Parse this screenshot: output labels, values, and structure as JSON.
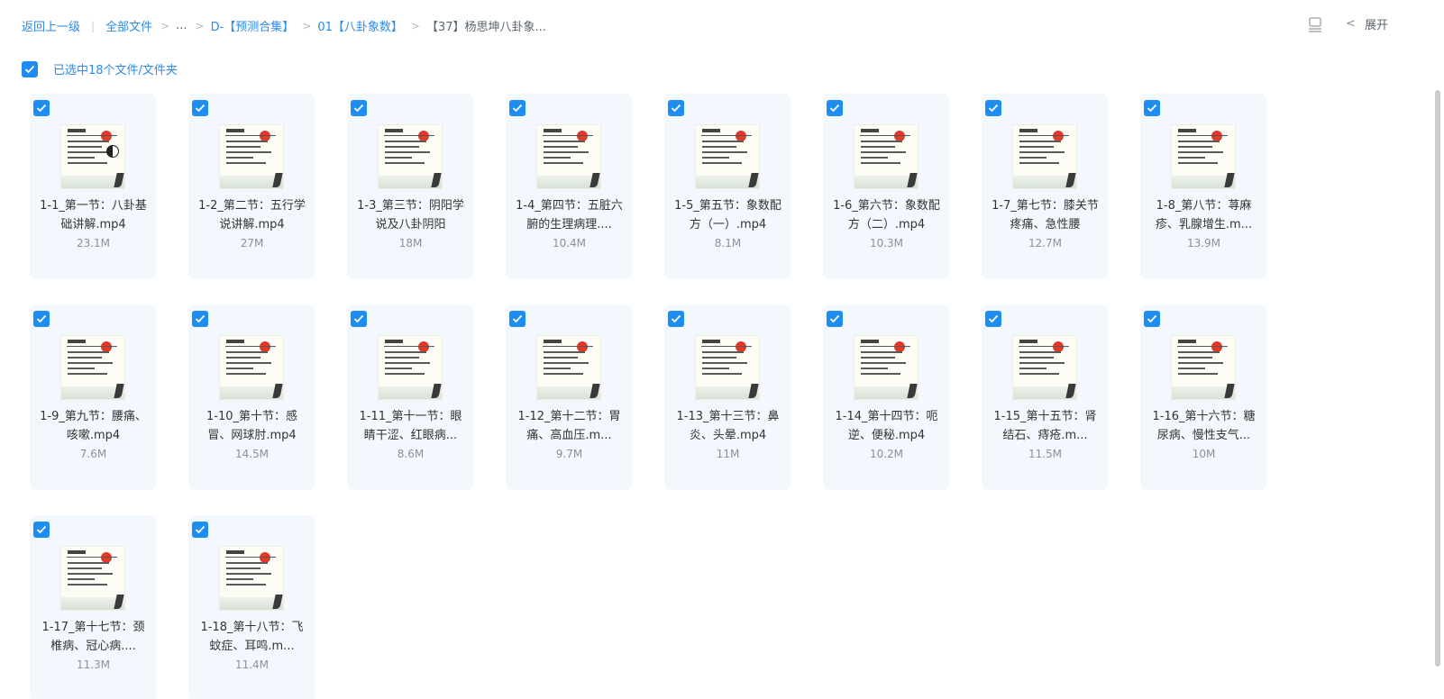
{
  "breadcrumb": {
    "back": "返回上一级",
    "root": "全部文件",
    "ellipsis": "...",
    "level1": "D-【预测合集】",
    "level2": "01【八卦象数】",
    "current": "【37】杨思坤八卦象..."
  },
  "toolbar": {
    "view_icon": "list-view-icon",
    "expand_label": "展开"
  },
  "selection": {
    "summary": "已选中18个文件/文件夹",
    "checked": true
  },
  "colors": {
    "accent": "#1e8cf0",
    "link": "#2c8ae8",
    "card_bg": "#f2f8fe"
  },
  "files": [
    {
      "name": "1-1_第一节：八卦基础讲解.mp4",
      "size": "23.1M"
    },
    {
      "name": "1-2_第二节：五行学说讲解.mp4",
      "size": "27M"
    },
    {
      "name": "1-3_第三节：阴阳学说及八卦阴阳",
      "size": "18M"
    },
    {
      "name": "1-4_第四节：五脏六腑的生理病理....",
      "size": "10.4M"
    },
    {
      "name": "1-5_第五节：象数配方（一）.mp4",
      "size": "8.1M"
    },
    {
      "name": "1-6_第六节：象数配方（二）.mp4",
      "size": "10.3M"
    },
    {
      "name": "1-7_第七节：膝关节疼痛、急性腰",
      "size": "12.7M"
    },
    {
      "name": "1-8_第八节：荨麻疹、乳腺增生.m...",
      "size": "13.9M"
    },
    {
      "name": "1-9_第九节：腰痛、咳嗽.mp4",
      "size": "7.6M"
    },
    {
      "name": "1-10_第十节：感冒、网球肘.mp4",
      "size": "14.5M"
    },
    {
      "name": "1-11_第十一节：眼睛干涩、红眼病...",
      "size": "8.6M"
    },
    {
      "name": "1-12_第十二节：胃痛、高血压.m...",
      "size": "9.7M"
    },
    {
      "name": "1-13_第十三节：鼻炎、头晕.mp4",
      "size": "11M"
    },
    {
      "name": "1-14_第十四节：呃逆、便秘.mp4",
      "size": "10.2M"
    },
    {
      "name": "1-15_第十五节：肾结石、痔疮.m...",
      "size": "11.5M"
    },
    {
      "name": "1-16_第十六节：糖尿病、慢性支气...",
      "size": "10M"
    },
    {
      "name": "1-17_第十七节：颈椎病、冠心病....",
      "size": "11.3M"
    },
    {
      "name": "1-18_第十八节：飞蚊症、耳鸣.m...",
      "size": "11.4M"
    }
  ]
}
